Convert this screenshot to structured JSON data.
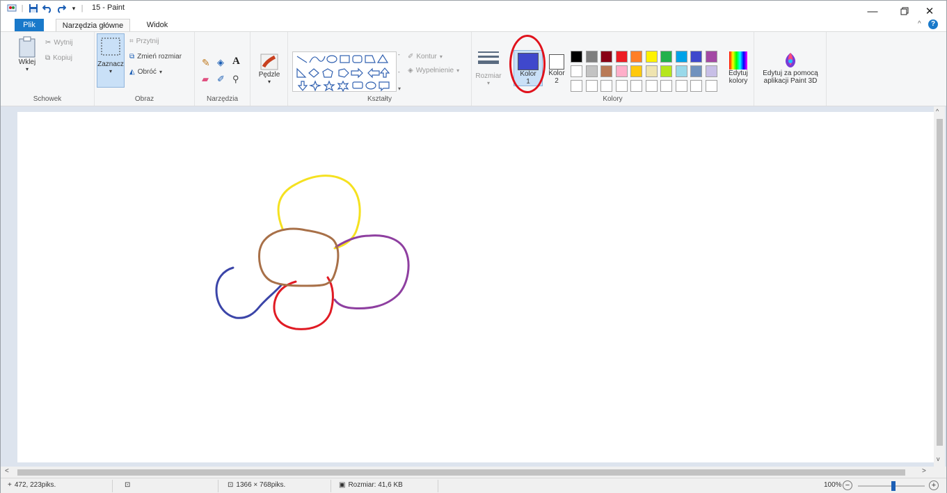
{
  "window": {
    "title": "15 - Paint"
  },
  "tabs": [
    {
      "label": "Plik"
    },
    {
      "label": "Narzędzia główne"
    },
    {
      "label": "Widok"
    }
  ],
  "groups": {
    "clipboard": {
      "label": "Schowek",
      "paste": "Wklej",
      "cut": "Wytnij",
      "copy": "Kopiuj"
    },
    "image": {
      "label": "Obraz",
      "select": "Zaznacz",
      "crop": "Przytnij",
      "resize": "Zmień rozmiar",
      "rotate": "Obróć"
    },
    "tools": {
      "label": "Narzędzia"
    },
    "brushes": {
      "label": "Pędzle"
    },
    "shapes": {
      "label": "Kształty",
      "outline": "Kontur",
      "fill": "Wypełnienie"
    },
    "colors": {
      "label": "Kolory",
      "size": "Rozmiar",
      "color1": "Kolor",
      "color1_num": "1",
      "color2": "Kolor",
      "color2_num": "2",
      "edit": "Edytuj",
      "edit2": "kolory",
      "color1_value": "#3f48cc",
      "color2_value": "#ffffff",
      "palette_row1": [
        "#000000",
        "#7f7f7f",
        "#880015",
        "#ed1c24",
        "#ff7f27",
        "#fff200",
        "#22b14c",
        "#00a2e8",
        "#3f48cc",
        "#a349a4"
      ],
      "palette_row2": [
        "#ffffff",
        "#c3c3c3",
        "#b97a57",
        "#ffaec9",
        "#ffc90e",
        "#efe4b0",
        "#b5e61d",
        "#99d9ea",
        "#7092be",
        "#c8bfe7"
      ]
    },
    "paint3d": {
      "line1": "Edytuj za pomocą",
      "line2": "aplikacji Paint 3D"
    }
  },
  "status": {
    "cursor": "472, 223piks.",
    "image_size": "1366 × 768piks.",
    "file_size": "Rozmiar: 41,6 KB",
    "zoom": "100%"
  },
  "drawing": {
    "strokes": [
      {
        "color": "#f5e120",
        "name": "yellow-petal"
      },
      {
        "color": "#8e3fa0",
        "name": "purple-petal"
      },
      {
        "color": "#e01b24",
        "name": "red-petal"
      },
      {
        "color": "#3b45a8",
        "name": "blue-curl"
      },
      {
        "color": "#a87048",
        "name": "brown-center"
      }
    ]
  },
  "accent": "#e0121c"
}
